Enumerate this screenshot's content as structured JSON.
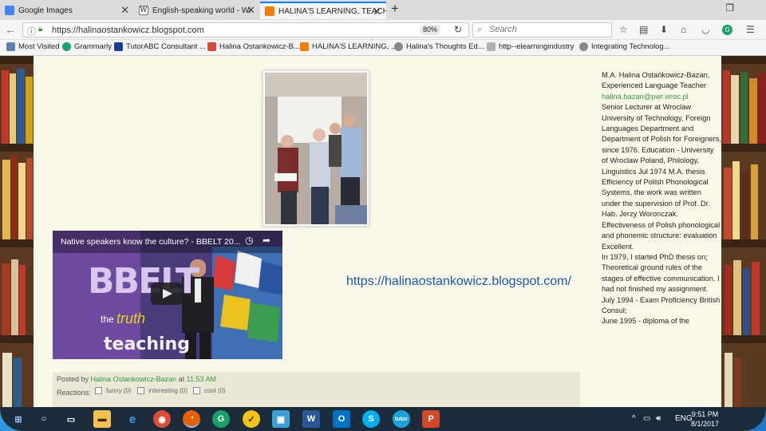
{
  "tabs": [
    {
      "label": "Google Images",
      "favicon": "google-favicon",
      "close": "✕"
    },
    {
      "label": "English-speaking world - Wi",
      "favicon": "wikipedia-favicon",
      "close": "✕"
    },
    {
      "label": "HALINA'S LEARNING, TEACH",
      "favicon": "blogger-favicon",
      "close": "✕"
    }
  ],
  "new_tab": "+",
  "navbar": {
    "url": "https://halinaostankowicz.blogspot.com",
    "zoom": "80%",
    "search_placeholder": "Search"
  },
  "bookmarks": [
    {
      "label": "Most Visited",
      "color": "#5a7fb0"
    },
    {
      "label": "Grammarly",
      "color": "#19a16a"
    },
    {
      "label": "TutorABC Consultant ...",
      "color": "#1a3d8f"
    },
    {
      "label": "Halina Ostankowicz-B...",
      "color": "#d84b3a"
    },
    {
      "label": "HALINA'S LEARNING, ...",
      "color": "#f57d00"
    },
    {
      "label": "Halina's Thoughts  Ed...",
      "color": "#888888"
    },
    {
      "label": "http--elearningindustry",
      "color": "#b0b0b0"
    },
    {
      "label": "Integrating Technolog...",
      "color": "#888888"
    }
  ],
  "post": {
    "video_title": "Native speakers know the culture? - BBELT 20...",
    "video_brand": "BBELT",
    "video_the": "the",
    "video_truth": "truth",
    "video_teaching": "teaching",
    "blog_link": "https://halinaostankowicz.blogspot.com/",
    "posted_by_prefix": "Posted by",
    "author": "Halina Ostankowicz-Bazan",
    "at": "at",
    "time": "11:53 AM",
    "reactions_label": "Reactions:",
    "reactions": [
      "funny (0)",
      "interesting (0)",
      "cool (0)"
    ]
  },
  "sidebar": {
    "intro": "M.A. Halina Ostańkowicz-Bazan, Experienced Language Teacher",
    "email": "halina.bazan@pwr.wroc.pl",
    "bio": "Senior Lecturer at Wroclaw University of Technology, Foreign Languages Department and Department of Polish for Foreigners, since 1976. Education - University of Wroclaw Poland, Philology, Linguistics Jul 1974 M.A. thesis Efficiency of Polish Phonological Systems, the work was written under the supervision of Prof. Dr. Hab. Jerzy Woronczak. Effectiveness of Polish phonological and phonemic structure: evaluation Excellent.",
    "phd": "In 1979, I started PhD thesis on; Theoretical ground rules of the stages of effective communication. I had not finished my assignment.",
    "exam": "July 1994 - Exam Proficiency British Consul;",
    "cut": "June 1995 - diploma of the"
  },
  "taskbar": {
    "apps": [
      "Windows",
      "Search",
      "Task View",
      "File Explorer",
      "Edge",
      "Chrome",
      "Firefox",
      "Grammarly",
      "Norton",
      "Remote Desktop",
      "Word",
      "Outlook",
      "Skype",
      "Tutor",
      "PowerPoint"
    ],
    "language": "ENG",
    "time": "9:51 PM",
    "date": "8/1/2017"
  }
}
